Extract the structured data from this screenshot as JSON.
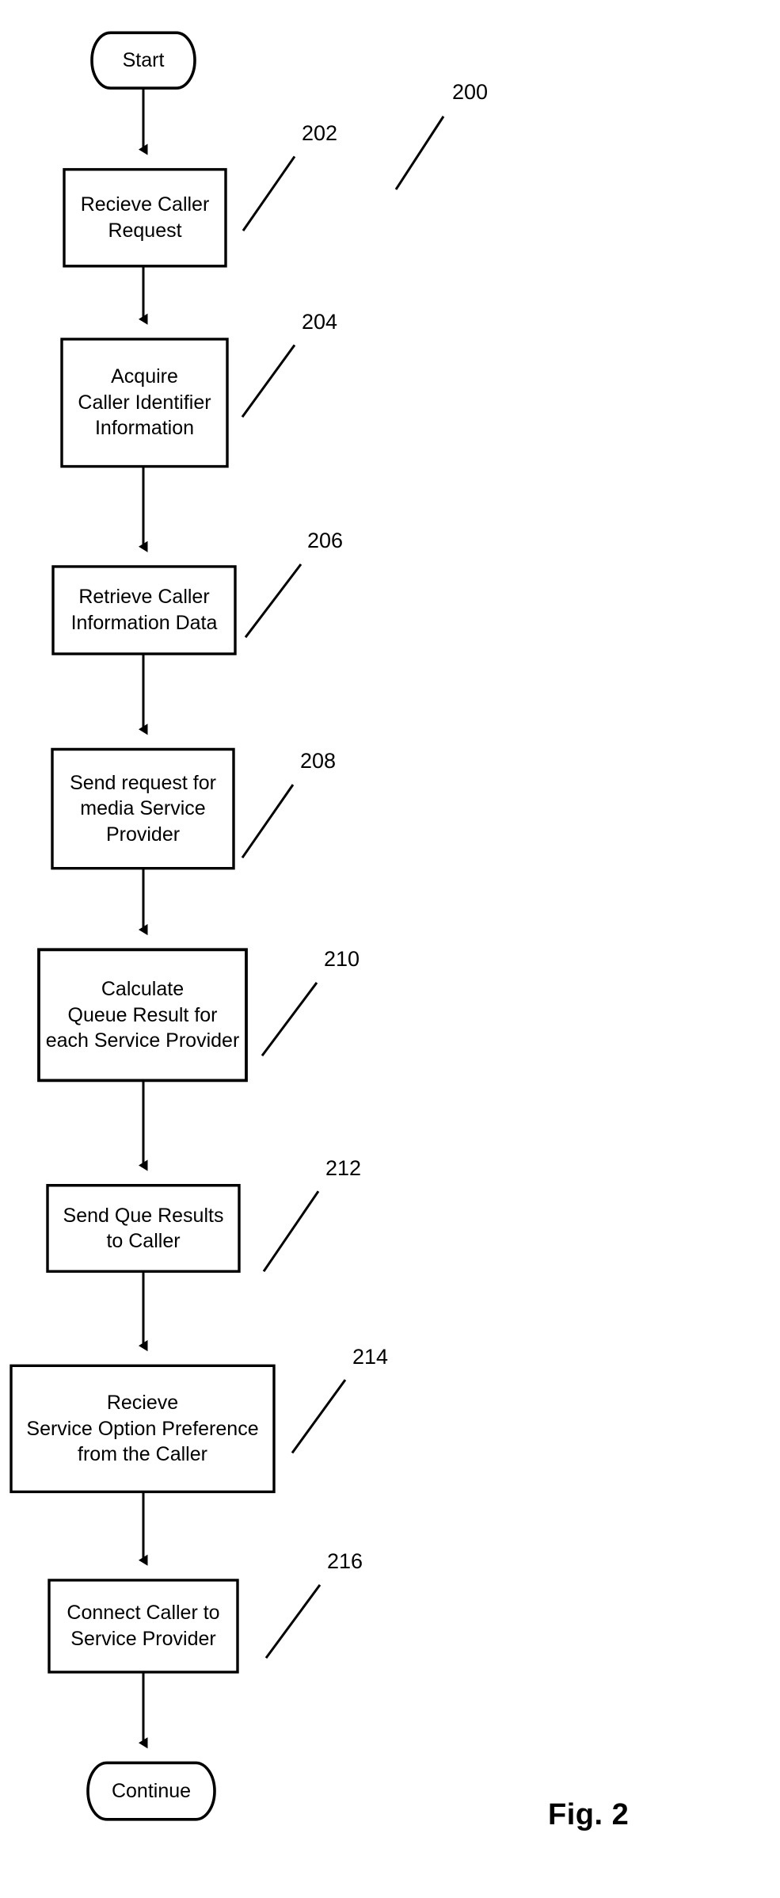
{
  "figure": {
    "caption": "Fig. 2",
    "diagram_reference": "200"
  },
  "nodes": [
    {
      "id": "start",
      "shape": "terminal",
      "lines": [
        "Start"
      ],
      "ref": null
    },
    {
      "id": "step-202",
      "shape": "process",
      "lines": [
        "Recieve Caller",
        "Request"
      ],
      "ref": "202"
    },
    {
      "id": "step-204",
      "shape": "process",
      "lines": [
        "Acquire",
        "Caller Identifier",
        "Information"
      ],
      "ref": "204"
    },
    {
      "id": "step-206",
      "shape": "process",
      "lines": [
        "Retrieve Caller",
        "Information Data"
      ],
      "ref": "206"
    },
    {
      "id": "step-208",
      "shape": "process",
      "lines": [
        "Send request for",
        "media Service",
        "Provider"
      ],
      "ref": "208"
    },
    {
      "id": "step-210",
      "shape": "process",
      "lines": [
        "Calculate",
        "Queue Result for",
        "each Service Provider"
      ],
      "ref": "210"
    },
    {
      "id": "step-212",
      "shape": "process",
      "lines": [
        "Send Que Results",
        "to Caller"
      ],
      "ref": "212"
    },
    {
      "id": "step-214",
      "shape": "process",
      "lines": [
        "Recieve",
        "Service Option Preference",
        "from the Caller"
      ],
      "ref": "214"
    },
    {
      "id": "step-216",
      "shape": "process",
      "lines": [
        "Connect Caller to",
        "Service Provider"
      ],
      "ref": "216"
    },
    {
      "id": "continue",
      "shape": "terminal",
      "lines": [
        "Continue"
      ],
      "ref": null
    }
  ],
  "labels": {
    "start": "Start",
    "continue": "Continue",
    "step_202_line1": "Recieve Caller",
    "step_202_line2": "Request",
    "step_204_line1": "Acquire",
    "step_204_line2": "Caller Identifier",
    "step_204_line3": "Information",
    "step_206_line1": "Retrieve Caller",
    "step_206_line2": "Information Data",
    "step_208_line1": "Send request for",
    "step_208_line2": "media Service",
    "step_208_line3": "Provider",
    "step_210_line1": "Calculate",
    "step_210_line2": "Queue Result for",
    "step_210_line3": "each Service Provider",
    "step_212_line1": "Send Que Results",
    "step_212_line2": "to Caller",
    "step_214_line1": "Recieve",
    "step_214_line2": "Service Option Preference",
    "step_214_line3": "from the Caller",
    "step_216_line1": "Connect Caller to",
    "step_216_line2": "Service Provider"
  },
  "reference_numerals": {
    "figure": "200",
    "n202": "202",
    "n204": "204",
    "n206": "206",
    "n208": "208",
    "n210": "210",
    "n212": "212",
    "n214": "214",
    "n216": "216"
  },
  "style": {
    "stroke_color": "#000000",
    "fill_color": "#ffffff",
    "background": "#ffffff"
  }
}
